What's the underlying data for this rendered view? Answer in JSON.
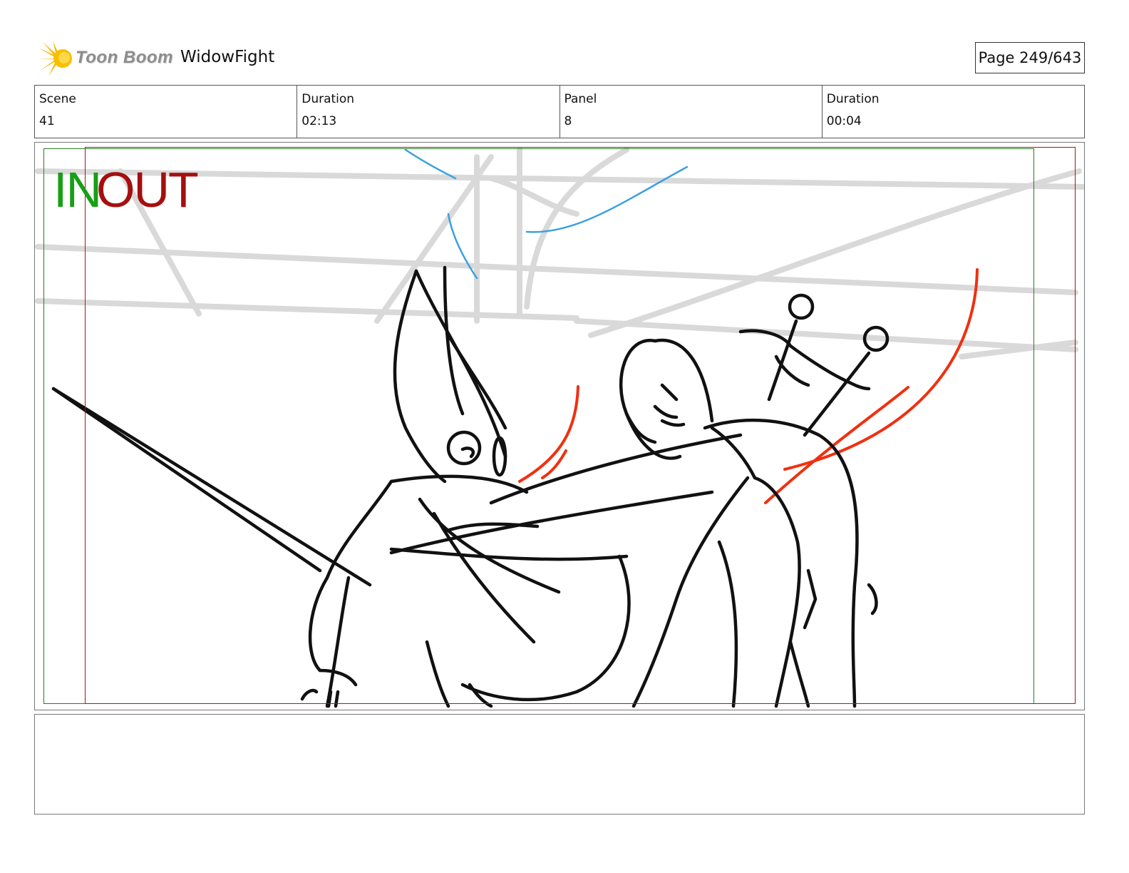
{
  "header": {
    "logo_text": "Toon Boom",
    "project_title": "WidowFight",
    "page": "Page 249/643"
  },
  "info": {
    "scene_label": "Scene",
    "scene_value": "41",
    "scene_duration_label": "Duration",
    "scene_duration_value": "02:13",
    "panel_label": "Panel",
    "panel_value": "8",
    "panel_duration_label": "Duration",
    "panel_duration_value": "00:04"
  },
  "panel": {
    "in_label": "IN",
    "out_label": "OUT"
  },
  "notes": {
    "text": ""
  },
  "colors": {
    "in_frame": "#2a7a2a",
    "out_frame": "#a01818",
    "in_text": "#16a016",
    "out_text": "#a50f0f",
    "motion_lines": "#f03010",
    "blue_lines": "#3aa0e0",
    "background_sketch": "#d9d9d9"
  }
}
